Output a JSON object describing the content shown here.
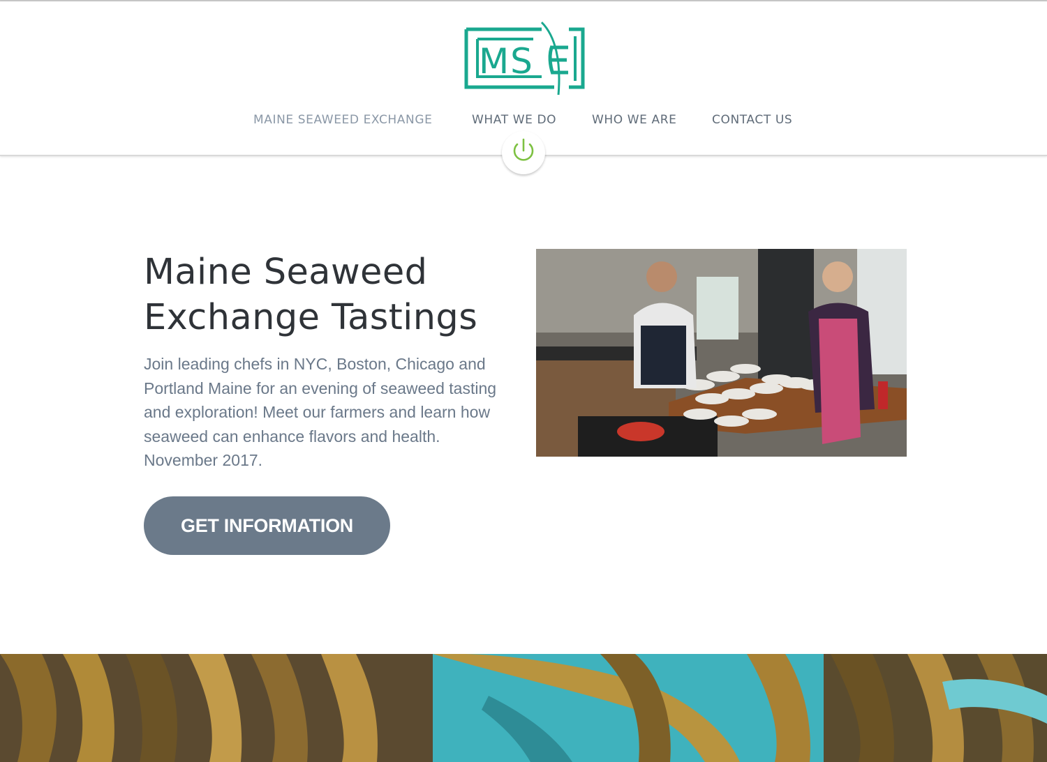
{
  "brand": {
    "logo_text": "MSE",
    "logo_color": "#1aa88f"
  },
  "nav": {
    "items": [
      {
        "label": "MAINE SEAWEED EXCHANGE"
      },
      {
        "label": "WHAT WE DO"
      },
      {
        "label": "WHO WE ARE"
      },
      {
        "label": "CONTACT US"
      }
    ]
  },
  "power_icon": {
    "icon": "power-icon",
    "color": "#7dc142"
  },
  "hero": {
    "title_line1": "Maine Seaweed",
    "title_line2": "Exchange Tastings",
    "body": "Join leading chefs in NYC, Boston, Chicago and Portland Maine for an evening of seaweed tasting and exploration! Meet our farmers and learn how seaweed can enhance flavors and health. November 2017.",
    "cta_label": "GET INFORMATION",
    "cta_color": "#6b7a8a"
  },
  "images": {
    "kitchen_photo": "kitchen-photo",
    "seaweed_banner": "seaweed-banner"
  }
}
